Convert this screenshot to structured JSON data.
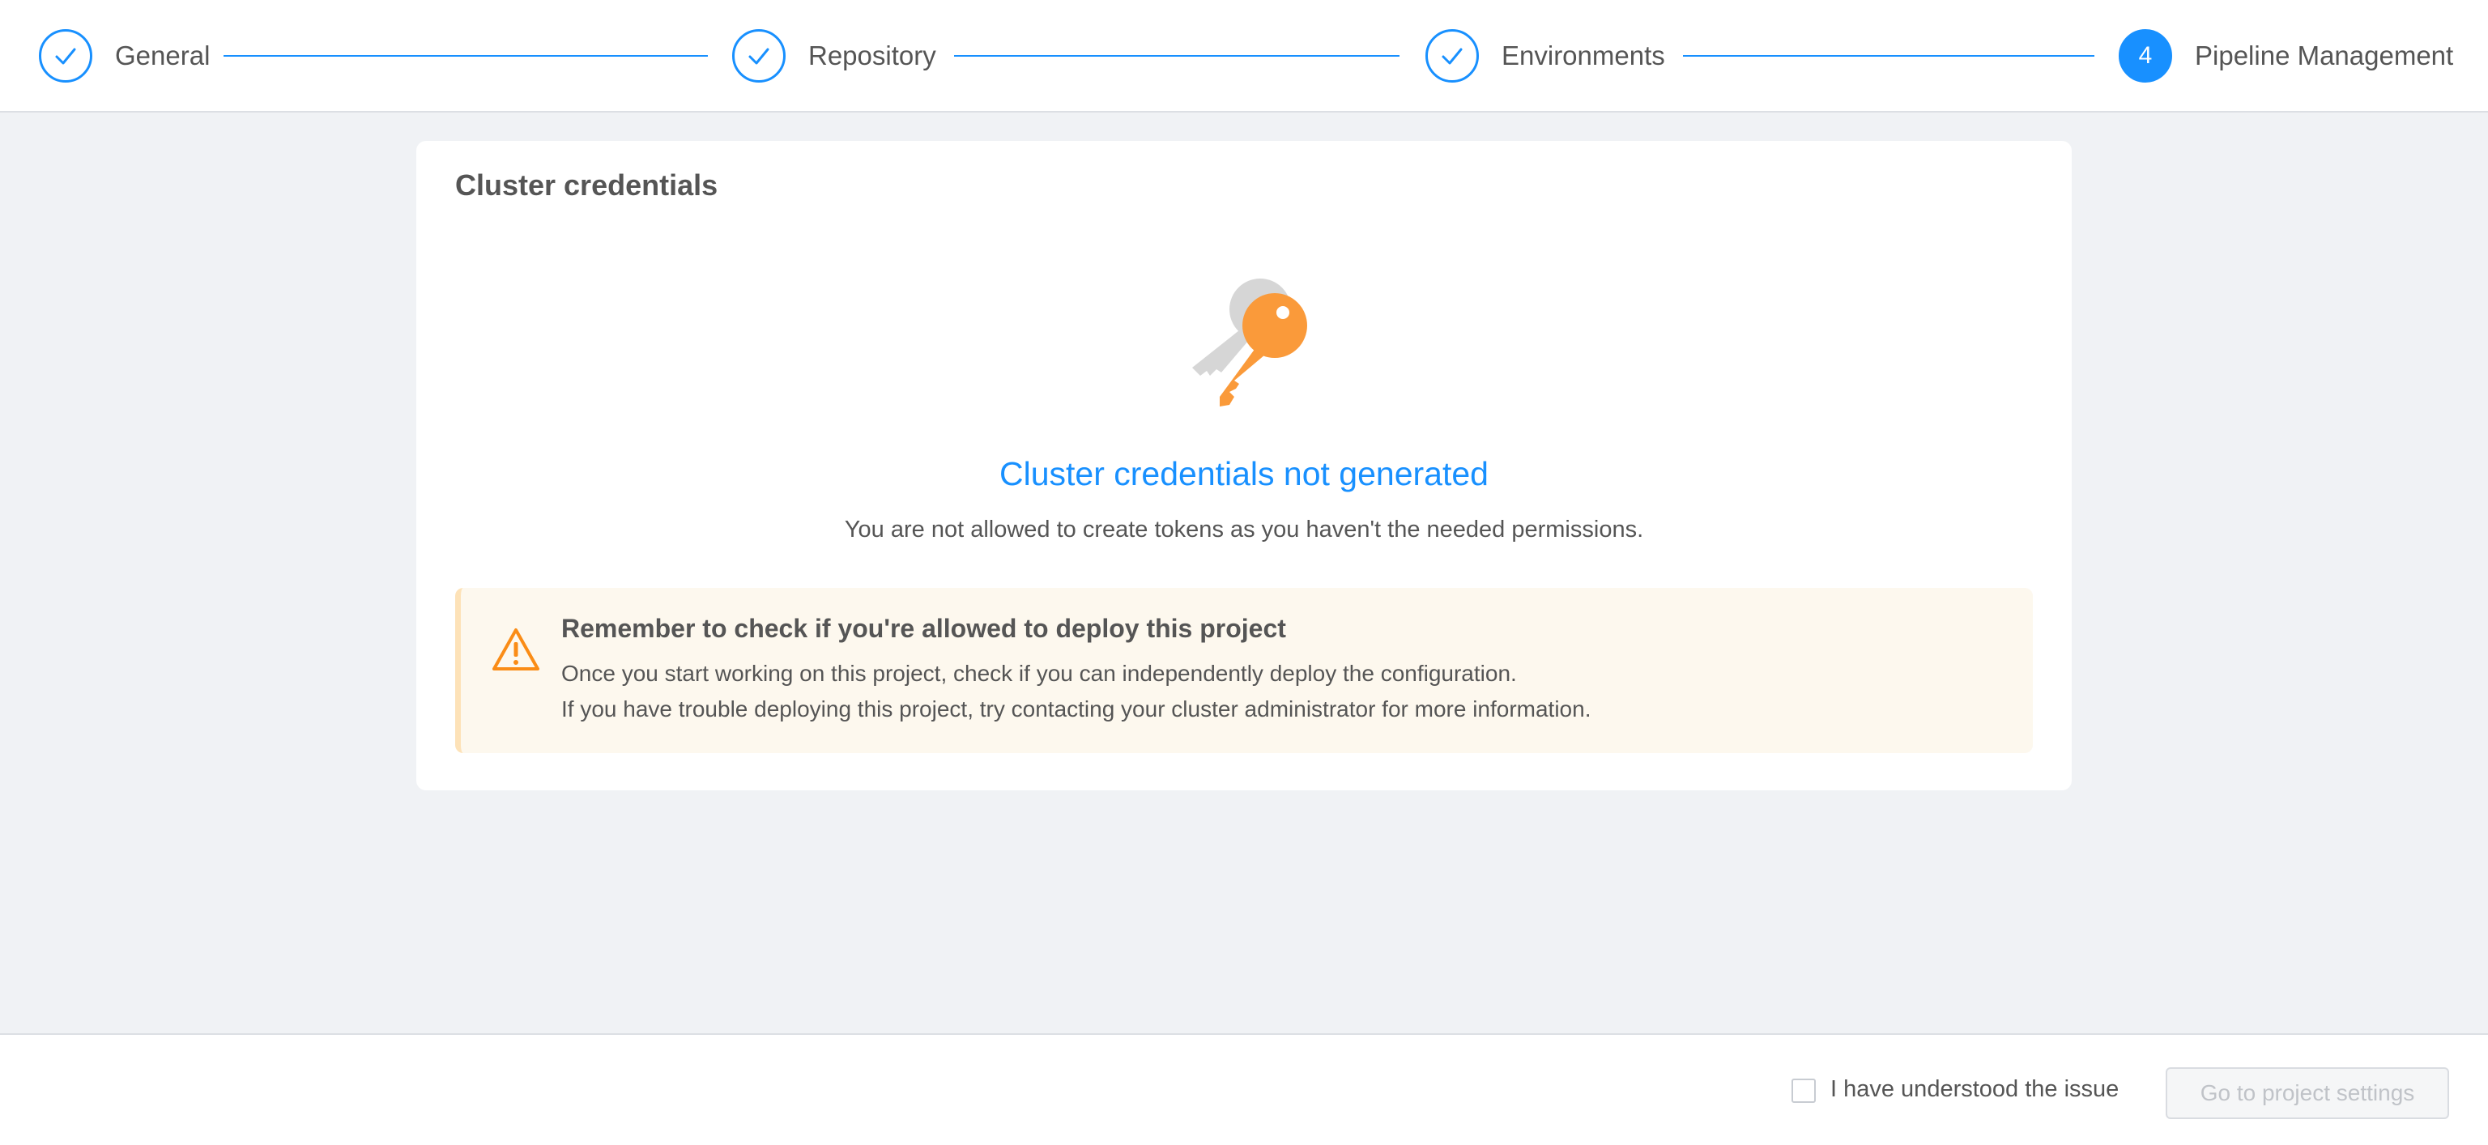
{
  "stepper": {
    "steps": [
      {
        "label": "General",
        "state": "completed"
      },
      {
        "label": "Repository",
        "state": "completed"
      },
      {
        "label": "Environments",
        "state": "completed"
      },
      {
        "label": "Pipeline Management",
        "state": "active",
        "number": "4"
      }
    ]
  },
  "card": {
    "title": "Cluster credentials",
    "empty_state": {
      "icon": "keys-icon",
      "title": "Cluster credentials not generated",
      "description": "You are not allowed to create tokens as you haven't the needed permissions."
    },
    "alert": {
      "icon": "warning-icon",
      "title": "Remember to check if you're allowed to deploy this project",
      "line1": "Once you start working on this project, check if you can independently deploy the configuration.",
      "line2": "If you have trouble deploying this project, try contacting your cluster administrator for more information."
    }
  },
  "footer": {
    "checkbox_label": "I have understood the issue",
    "checkbox_checked": false,
    "button_label": "Go to project settings",
    "button_disabled": true
  },
  "colors": {
    "accent": "#1890ff",
    "warning": "#fa8c16",
    "alert_background": "#fdf8ee"
  }
}
